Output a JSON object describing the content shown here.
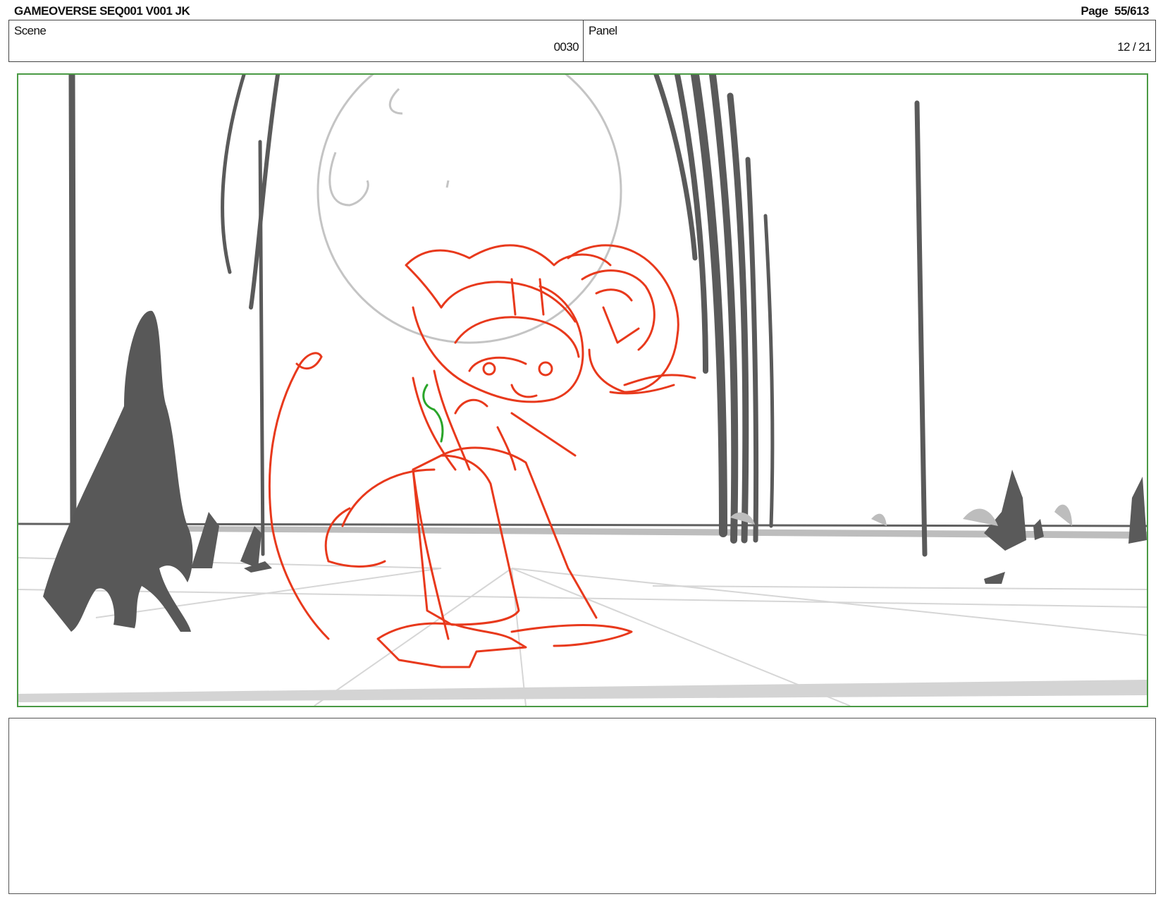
{
  "header": {
    "doc_title": "GAMEOVERSE SEQ001 V001 JK",
    "page_label": "Page",
    "page_value": "55/613"
  },
  "info": {
    "scene_label": "Scene",
    "scene_value": "0030",
    "panel_label": "Panel",
    "panel_value": "12 / 21"
  },
  "panel_image": {
    "description_icon": "storyboard-sketch",
    "colors": {
      "frame_border": "#4a9a44",
      "character_lines": "#e8391c",
      "background_dark": "#585858",
      "background_light": "#c9c9c9",
      "accent_green": "#2aa52a"
    }
  },
  "notes": {
    "text": ""
  }
}
